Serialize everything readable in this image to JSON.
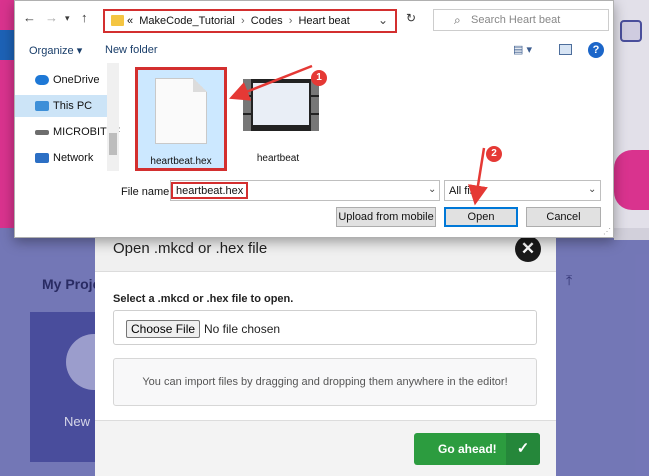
{
  "file_dialog": {
    "breadcrumb": [
      "«",
      "MakeCode_Tutorial",
      "›",
      "Codes",
      "›",
      "Heart beat"
    ],
    "search_placeholder": "Search Heart beat",
    "toolbar": {
      "organize": "Organize ▾",
      "new_folder": "New folder"
    },
    "nav_items": [
      {
        "label": "OneDrive",
        "icon": "cloud-icon",
        "color": "#1e78d6"
      },
      {
        "label": "This PC",
        "icon": "monitor-icon",
        "color": "#3d8fd8",
        "selected": true
      },
      {
        "label": "MICROBIT (F",
        "icon": "drive-icon",
        "color": "#6d6d6d"
      },
      {
        "label": "Network",
        "icon": "network-icon",
        "color": "#2c6fc4"
      }
    ],
    "files": [
      {
        "label": "heartbeat.hex",
        "icon": "document-icon",
        "selected": true
      },
      {
        "label": "heartbeat",
        "icon": "video-icon",
        "selected": false
      }
    ],
    "file_name_label": "File name:",
    "file_name_value": "heartbeat.hex",
    "file_type_value": "All files",
    "buttons": {
      "upload": "Upload from mobile",
      "open": "Open",
      "cancel": "Cancel"
    }
  },
  "modal": {
    "title": "Open .mkcd or .hex file",
    "instruction": "Select a .mkcd or .hex file to open.",
    "choose_file": "Choose File",
    "no_file": "No file chosen",
    "hint": "You can import files by dragging and dropping them anywhere in the editor!",
    "go_label": "Go ahead!"
  },
  "background": {
    "my_projects": "My Proje",
    "new_label": "New"
  },
  "annotations": {
    "badge_1": "1",
    "badge_2": "2",
    "color": "#e53935"
  }
}
